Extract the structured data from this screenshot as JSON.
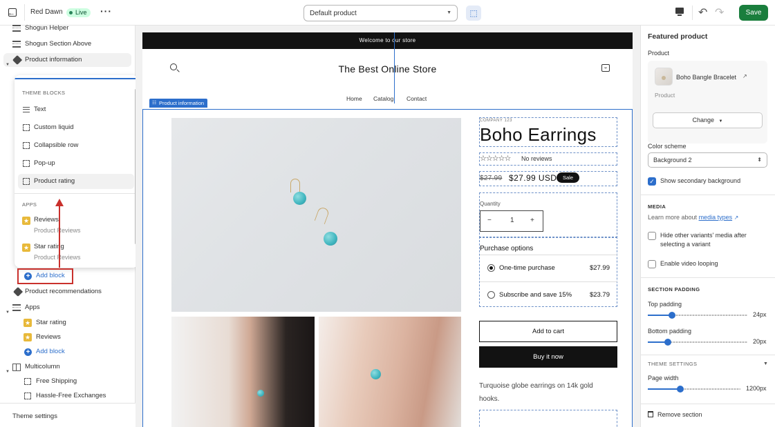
{
  "topbar": {
    "store_name": "Red Dawn",
    "status": "Live",
    "template_select": "Default product",
    "save_label": "Save"
  },
  "sidebar": {
    "items": {
      "shogun_helper": "Shogun Helper",
      "shogun_section_above": "Shogun Section Above",
      "product_information": "Product information",
      "text_partial": "Text",
      "product_recommendations": "Product recommendations",
      "apps": "Apps",
      "star_rating": "Star rating",
      "reviews": "Reviews",
      "add_block": "Add block",
      "multicolumn": "Multicolumn",
      "free_shipping": "Free Shipping",
      "hassle_free": "Hassle-Free Exchanges"
    },
    "popup": {
      "theme_blocks_header": "THEME BLOCKS",
      "blocks": [
        "Text",
        "Custom liquid",
        "Collapsible row",
        "Pop-up",
        "Product rating"
      ],
      "apps_header": "APPS",
      "apps": [
        {
          "name": "Reviews",
          "source": "Product Reviews"
        },
        {
          "name": "Star rating",
          "source": "Product Reviews"
        }
      ]
    },
    "add_block_label": "Add block",
    "theme_settings": "Theme settings"
  },
  "preview": {
    "announcement": "Welcome to our store",
    "store_title": "The Best Online Store",
    "nav": [
      "Home",
      "Catalog",
      "Contact"
    ],
    "section_label": "Product information",
    "vendor": "COMPANY 123",
    "product_title": "Boho Earrings",
    "stars": "☆☆☆☆☆",
    "reviews_text": "No reviews",
    "compare_price": "$27.99",
    "price": "$27.99 USD",
    "sale_badge": "Sale",
    "quantity_label": "Quantity",
    "quantity_value": "1",
    "quantity_minus": "−",
    "quantity_plus": "+",
    "purchase_options_label": "Purchase options",
    "purchase_options": [
      {
        "name": "One-time purchase",
        "price": "$27.99",
        "selected": true
      },
      {
        "name": "Subscribe and save 15%",
        "price": "$23.79",
        "selected": false
      }
    ],
    "add_to_cart": "Add to cart",
    "buy_now": "Buy it now",
    "description": "Turquoise globe earrings on 14k gold hooks."
  },
  "settings": {
    "title": "Featured product",
    "product_label": "Product",
    "product_name": "Boho Bangle Bracelet",
    "product_sub": "Product",
    "change_label": "Change",
    "color_scheme_label": "Color scheme",
    "color_scheme_value": "Background 2",
    "show_secondary_bg": "Show secondary background",
    "media_header": "MEDIA",
    "learn_more": "Learn more about",
    "media_types_link": "media types",
    "hide_variants": "Hide other variants' media after selecting a variant",
    "enable_video_looping": "Enable video looping",
    "section_padding_header": "SECTION PADDING",
    "top_padding_label": "Top padding",
    "top_padding_value": "24px",
    "top_padding_fraction": 0.24,
    "bottom_padding_label": "Bottom padding",
    "bottom_padding_value": "20px",
    "bottom_padding_fraction": 0.2,
    "theme_settings_header": "THEME SETTINGS",
    "page_width_label": "Page width",
    "page_width_value": "1200px",
    "page_width_fraction": 0.35,
    "remove_section": "Remove section"
  },
  "colors": {
    "accent": "#2c6ecb",
    "save": "#1a7e3d",
    "highlight": "#c9302c",
    "dark": "#121212"
  }
}
